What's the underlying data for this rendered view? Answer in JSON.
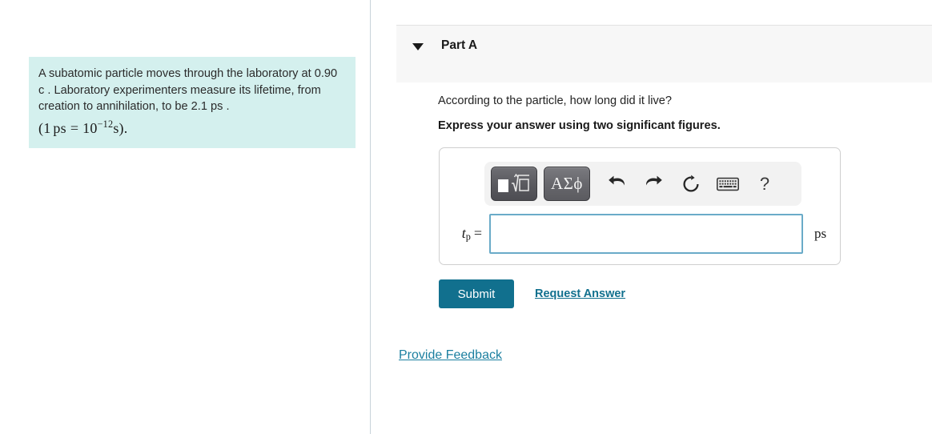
{
  "problem": {
    "text": "A subatomic particle moves through the laboratory at 0.90 c . Laboratory experimenters measure its lifetime, from creation to annihilation, to be 2.1 ps .",
    "formula_open": "(1",
    "formula_unit": "ps",
    "formula_equals": "=",
    "formula_base": "10",
    "formula_exponent": "−12",
    "formula_tail": "s).",
    "background_color": "#d4f0ee"
  },
  "part": {
    "title": "Part A",
    "collapsed": false,
    "question": "According to the particle, how long did it live?",
    "instruction": "Express your answer using two significant figures."
  },
  "toolbar": {
    "buttons": [
      {
        "name": "math-template-button",
        "label": ""
      },
      {
        "name": "greek-symbols-button",
        "label": "ΑΣϕ"
      },
      {
        "name": "undo-button",
        "label": ""
      },
      {
        "name": "redo-button",
        "label": ""
      },
      {
        "name": "reset-button",
        "label": ""
      },
      {
        "name": "keyboard-button",
        "label": ""
      },
      {
        "name": "help-button",
        "label": "?"
      }
    ],
    "help_label": "?"
  },
  "answer": {
    "variable": "t",
    "subscript": "p",
    "equals": "=",
    "value": "",
    "placeholder": "",
    "unit": "ps",
    "input_border_color": "#6aabc8"
  },
  "actions": {
    "submit_label": "Submit",
    "request_answer_label": "Request Answer",
    "accent_color": "#11708e"
  },
  "footer": {
    "provide_feedback_label": "Provide Feedback",
    "link_color": "#1b7fa0"
  }
}
